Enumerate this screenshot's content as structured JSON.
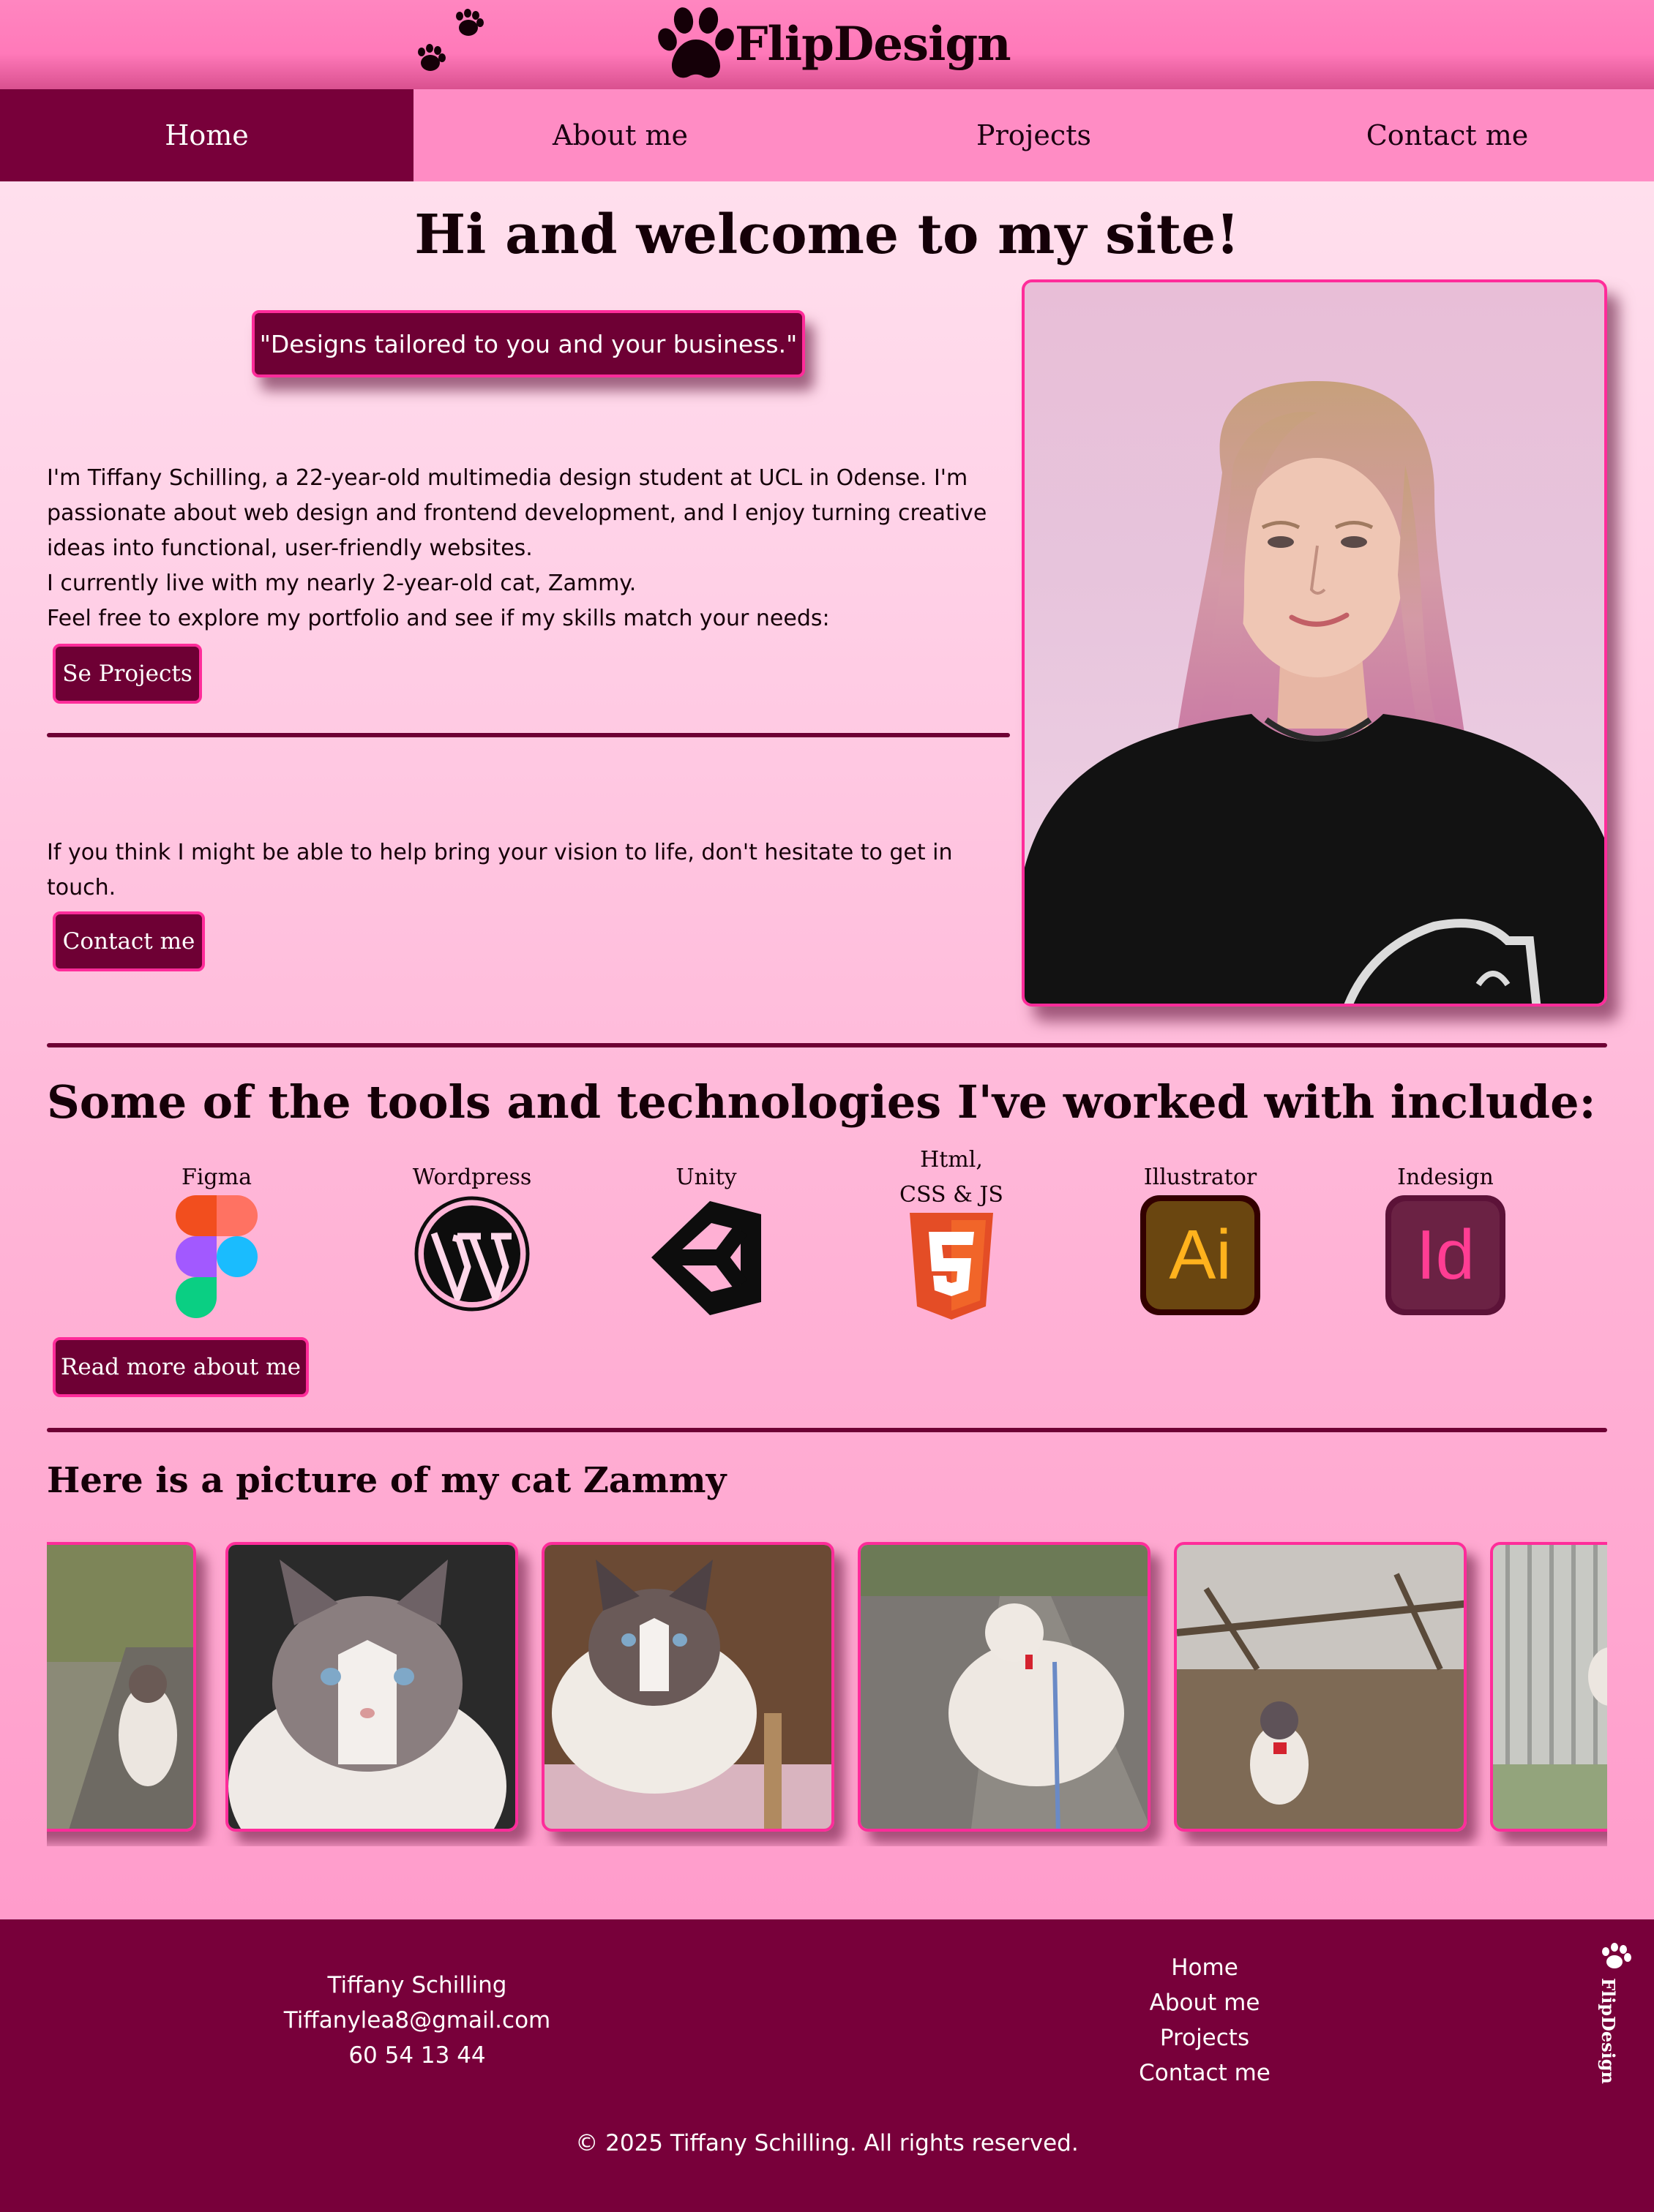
{
  "header": {
    "logo_text": "FlipDesign"
  },
  "nav": {
    "items": [
      {
        "label": "Home",
        "active": true
      },
      {
        "label": "About me",
        "active": false
      },
      {
        "label": "Projects",
        "active": false
      },
      {
        "label": "Contact me",
        "active": false
      }
    ]
  },
  "hero": {
    "title": "Hi and welcome to my site!",
    "quote": "\"Designs tailored to you and your business.\"",
    "intro_lines": [
      "I'm Tiffany Schilling, a 22-year-old multimedia design student at UCL in Odense. I'm",
      "passionate about web design and frontend development, and I enjoy turning creative",
      "ideas into functional, user-friendly websites.",
      "I currently live with my nearly 2-year-old cat, Zammy.",
      "Feel free to explore my portfolio and see if my skills match your needs:"
    ],
    "see_projects_label": "Se Projects",
    "contact_lines": [
      "If you think I might be able to help bring your vision to life, don't hesitate to get in",
      "touch."
    ],
    "contact_label": "Contact me"
  },
  "tools": {
    "heading": "Some of the tools and technologies I've worked with include:",
    "items": [
      {
        "label": "Figma",
        "icon": "figma-icon"
      },
      {
        "label": "Wordpress",
        "icon": "wordpress-icon"
      },
      {
        "label": "Unity",
        "icon": "unity-icon"
      },
      {
        "label": "Html,",
        "label2": "CSS & JS",
        "icon": "html5-icon"
      },
      {
        "label": "Illustrator",
        "icon": "illustrator-icon"
      },
      {
        "label": "Indesign",
        "icon": "indesign-icon"
      }
    ],
    "illustrator_glyph": "Ai",
    "indesign_glyph": "Id",
    "read_more_label": "Read more about me"
  },
  "gallery": {
    "heading": "Here is a picture of my cat Zammy"
  },
  "footer": {
    "name": "Tiffany Schilling",
    "email": "Tiffanylea8@gmail.com",
    "phone": "60 54 13 44",
    "links": [
      "Home",
      "About me",
      "Projects",
      "Contact me"
    ],
    "logo_text": "FlipDesign",
    "copyright": "© 2025 Tiffany Schilling. All rights reserved."
  },
  "colors": {
    "accent_dark": "#78003a",
    "accent_border": "#ff2c9a",
    "nav_bg": "#ff8cc4",
    "header_bg": "#ff79b9"
  }
}
